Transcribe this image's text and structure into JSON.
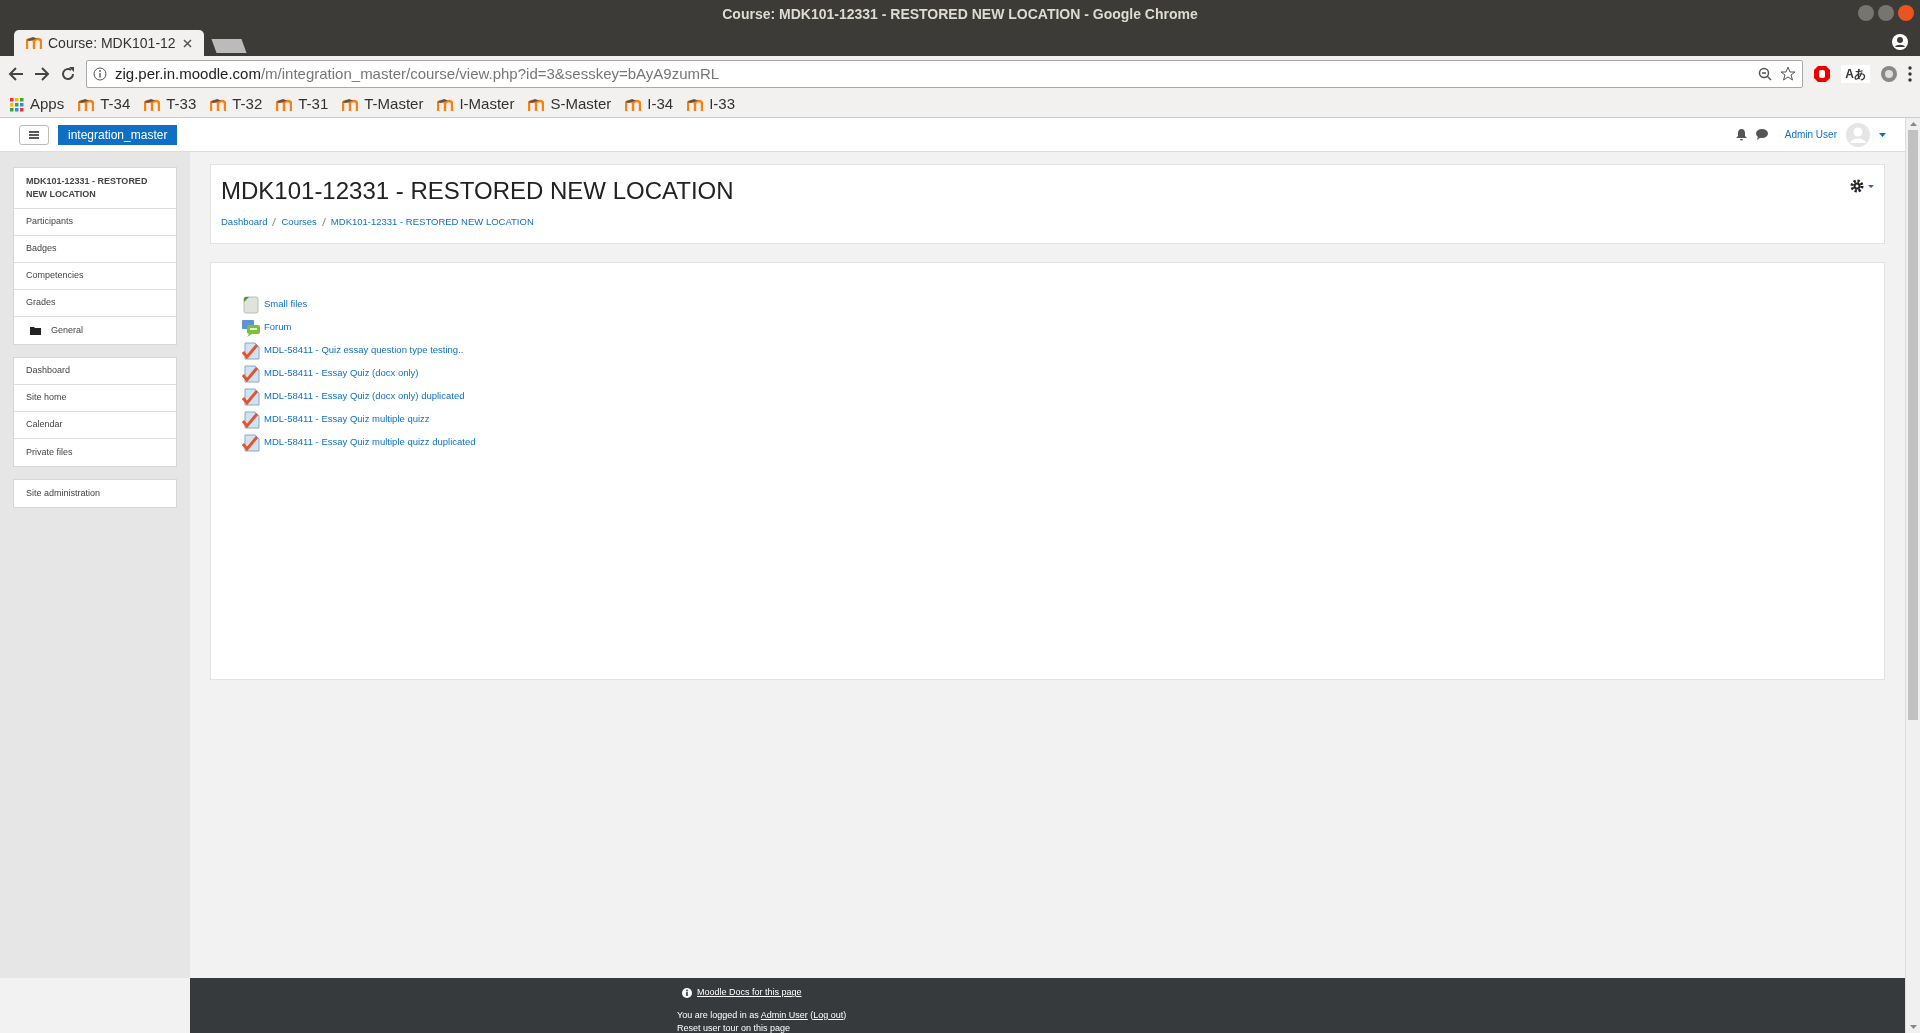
{
  "window": {
    "title": "Course: MDK101-12331 - RESTORED NEW LOCATION - Google Chrome"
  },
  "tabs": [
    {
      "label": "Course: MDK101-12",
      "selected": true
    }
  ],
  "address_bar": {
    "host": "zig.per.in.moodle.com",
    "path": "/m/integration_master/course/view.php?id=3&sesskey=bAyA9zumRL"
  },
  "bookmarks": [
    {
      "label": "Apps",
      "kind": "apps"
    },
    {
      "label": "T-34",
      "kind": "site"
    },
    {
      "label": "T-33",
      "kind": "site"
    },
    {
      "label": "T-32",
      "kind": "site"
    },
    {
      "label": "T-31",
      "kind": "site"
    },
    {
      "label": "T-Master",
      "kind": "site"
    },
    {
      "label": "I-Master",
      "kind": "site"
    },
    {
      "label": "S-Master",
      "kind": "site"
    },
    {
      "label": "I-34",
      "kind": "site"
    },
    {
      "label": "I-33",
      "kind": "site"
    }
  ],
  "toolbar": {
    "translate_label": "Aあ"
  },
  "navbar": {
    "site_name": "integration_master",
    "user_name": "Admin User"
  },
  "sidebar": {
    "groups": [
      [
        {
          "label": "MDK101-12331 - RESTORED NEW LOCATION",
          "kind": "course"
        },
        {
          "label": "Participants",
          "kind": "link"
        },
        {
          "label": "Badges",
          "kind": "link"
        },
        {
          "label": "Competencies",
          "kind": "link"
        },
        {
          "label": "Grades",
          "kind": "link"
        },
        {
          "label": "General",
          "kind": "section"
        }
      ],
      [
        {
          "label": "Dashboard",
          "kind": "link"
        },
        {
          "label": "Site home",
          "kind": "link"
        },
        {
          "label": "Calendar",
          "kind": "link"
        },
        {
          "label": "Private files",
          "kind": "link"
        }
      ],
      [
        {
          "label": "Site administration",
          "kind": "link"
        }
      ]
    ]
  },
  "course": {
    "title": "MDK101-12331 - RESTORED NEW LOCATION",
    "breadcrumb": [
      "Dashboard",
      "Courses",
      "MDK101-12331 - RESTORED NEW LOCATION"
    ]
  },
  "activities": [
    {
      "label": "Small files",
      "kind": "resource"
    },
    {
      "label": "Forum",
      "kind": "forum"
    },
    {
      "label": "MDL-58411 - Quiz essay question type testing..",
      "kind": "quiz"
    },
    {
      "label": "MDL-58411 - Essay Quiz (docx only)",
      "kind": "quiz"
    },
    {
      "label": "MDL-58411 - Essay Quiz (docx only) duplicated",
      "kind": "quiz"
    },
    {
      "label": "MDL-58411 - Essay Quiz multiple quizz",
      "kind": "quiz"
    },
    {
      "label": "MDL-58411 - Essay Quiz multiple quizz duplicated",
      "kind": "quiz"
    }
  ],
  "footer": {
    "docs_link": "Moodle Docs for this page",
    "login_prefix": "You are logged in as",
    "login_user": "Admin User",
    "paren_open": "(",
    "logout": "Log out",
    "paren_close": ")",
    "reset_tour": "Reset user tour on this page"
  }
}
